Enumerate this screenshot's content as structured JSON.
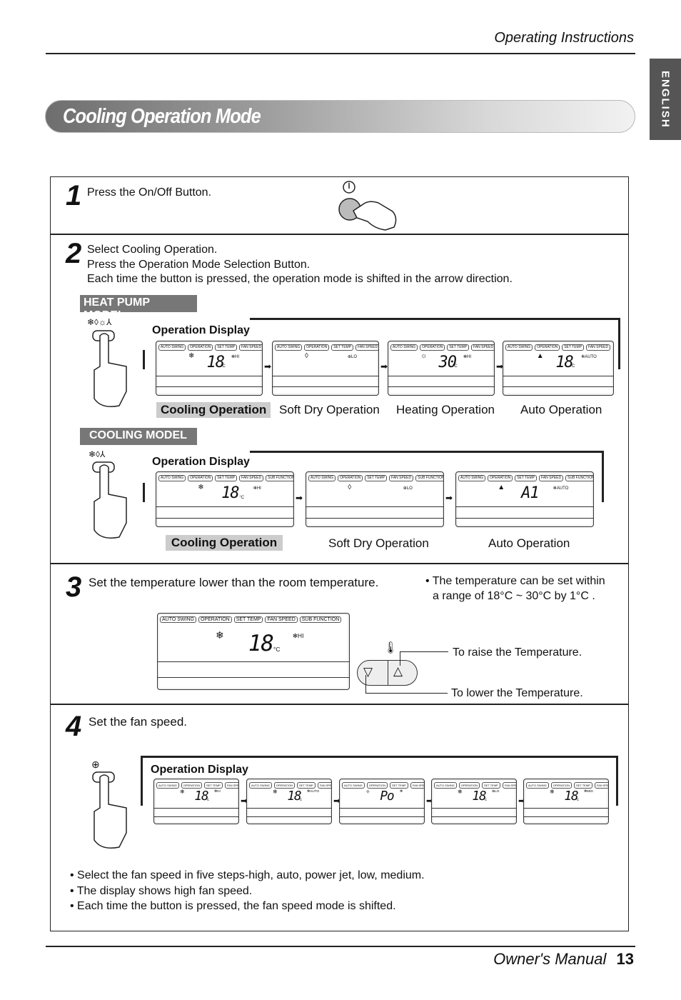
{
  "header": {
    "section": "Operating Instructions",
    "side_tab": "ENGLISH"
  },
  "title": "Cooling Operation Mode",
  "steps": [
    {
      "num": "1",
      "lines": [
        "Press the On/Off Button."
      ]
    },
    {
      "num": "2",
      "lines": [
        "Select Cooling Operation.",
        "Press the Operation Mode Selection Button.",
        "Each time the button is pressed, the operation mode is shifted in the arrow direction."
      ]
    },
    {
      "num": "3",
      "lines": [
        "Set the temperature lower than the room temperature."
      ],
      "note": [
        "• The temperature can be set within",
        "a range of 18°C ~ 30°C by 1°C ."
      ],
      "raise": "To raise the Temperature.",
      "lower": "To lower the Temperature."
    },
    {
      "num": "4",
      "lines": [
        "Set the fan speed."
      ],
      "bullets": [
        "• Select the fan speed in five steps-high, auto, power jet, low, medium.",
        "• The display shows high fan speed.",
        "• Each time the button is pressed, the fan speed mode is shifted."
      ]
    }
  ],
  "operation_display": "Operation Display",
  "heat_pump": {
    "badge": "HEAT PUMP MODEL",
    "icons": "❄◊☼⅄",
    "modes": [
      "Cooling Operation",
      "Soft Dry Operation",
      "Heating Operation",
      "Auto Operation"
    ],
    "displays": [
      {
        "labels": [
          "AUTO SWING",
          "OPERATION",
          "SET TEMP",
          "FAN SPEED"
        ],
        "mode_icon": "❄",
        "temp": "18",
        "unit": "°C",
        "fan": "✻HI"
      },
      {
        "labels": [
          "AUTO SWING",
          "OPERATION",
          "SET TEMP",
          "FAN SPEED"
        ],
        "mode_icon": "◊",
        "temp": "",
        "unit": "",
        "fan": "⊕LO"
      },
      {
        "labels": [
          "AUTO SWING",
          "OPERATION",
          "SET TEMP",
          "FAN SPEED"
        ],
        "mode_icon": "☼",
        "temp": "30",
        "unit": "°C",
        "fan": "✻HI"
      },
      {
        "labels": [
          "AUTO SWING",
          "OPERATION",
          "SET TEMP",
          "FAN SPEED"
        ],
        "mode_icon": "▲",
        "temp": "18",
        "unit": "°C",
        "fan": "✻AUTO"
      }
    ]
  },
  "cooling_model": {
    "badge": "COOLING MODEL",
    "icons": "❄◊⅄",
    "modes": [
      "Cooling Operation",
      "Soft Dry Operation",
      "Auto Operation"
    ],
    "displays": [
      {
        "labels": [
          "AUTO SWING",
          "OPERATION",
          "SET TEMP",
          "FAN SPEED",
          "SUB FUNCTION"
        ],
        "mode_icon": "❄",
        "temp": "18",
        "unit": "°C",
        "fan": "✻HI"
      },
      {
        "labels": [
          "AUTO SWING",
          "OPERATION",
          "SET TEMP",
          "FAN SPEED",
          "SUB FUNCTION"
        ],
        "mode_icon": "◊",
        "temp": "",
        "unit": "",
        "fan": "⊕LO"
      },
      {
        "labels": [
          "AUTO SWING",
          "OPERATION",
          "SET TEMP",
          "FAN SPEED",
          "SUB FUNCTION"
        ],
        "mode_icon": "▲",
        "temp": "A1",
        "unit": "",
        "fan": "✻AUTO"
      }
    ]
  },
  "step3_display": {
    "labels": [
      "AUTO SWING",
      "OPERATION",
      "SET TEMP",
      "FAN SPEED",
      "SUB FUNCTION"
    ],
    "mode_icon": "❄",
    "temp": "18",
    "unit": "°C",
    "fan": "✻HI"
  },
  "fan_displays": [
    {
      "labels": [
        "AUTO SWING",
        "OPERATION",
        "SET TEMP",
        "FAN SPEED"
      ],
      "mode_icon": "❄",
      "temp": "18",
      "unit": "°C",
      "fan": "✻HI"
    },
    {
      "labels": [
        "AUTO SWING",
        "OPERATION",
        "SET TEMP",
        "FAN SPEED"
      ],
      "mode_icon": "❄",
      "temp": "18",
      "unit": "°C",
      "fan": "✻AUTO"
    },
    {
      "labels": [
        "AUTO SWING",
        "OPERATION",
        "SET TEMP",
        "FAN SPEED"
      ],
      "mode_icon": "✧",
      "temp": "Po",
      "unit": "",
      "fan": "✻"
    },
    {
      "labels": [
        "AUTO SWING",
        "OPERATION",
        "SET TEMP",
        "FAN SPEED"
      ],
      "mode_icon": "❄",
      "temp": "18",
      "unit": "°C",
      "fan": "⊕LO"
    },
    {
      "labels": [
        "AUTO SWING",
        "OPERATION",
        "SET TEMP",
        "FAN SPEED"
      ],
      "mode_icon": "❄",
      "temp": "18",
      "unit": "°C",
      "fan": "✻MID"
    }
  ],
  "footer": {
    "manual": "Owner's Manual",
    "page": "13"
  }
}
